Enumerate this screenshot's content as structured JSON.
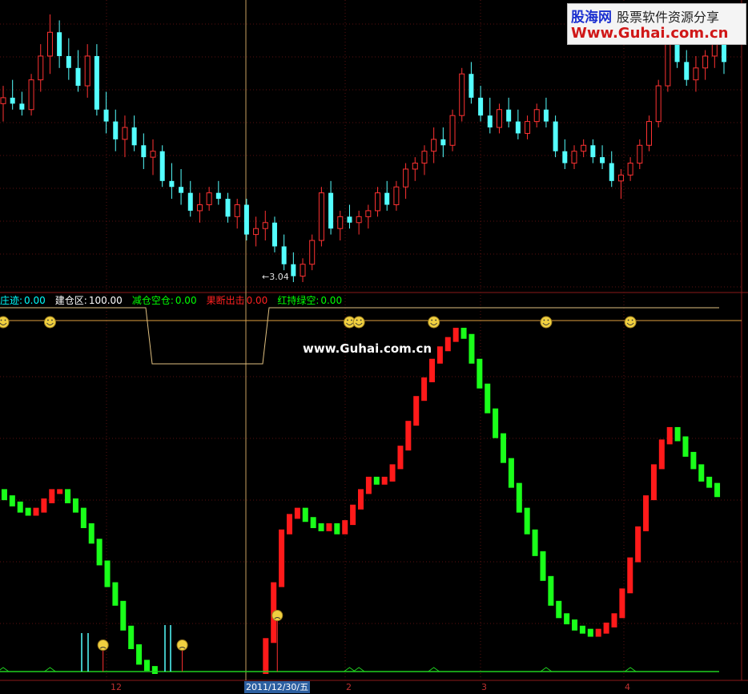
{
  "watermark": {
    "site_cn": "股海网",
    "slogan": "股票软件资源分享",
    "url": "Www.Guhai.com.cn"
  },
  "mid_watermark": "www.Guhai.com.cn",
  "indicator_legend": [
    {
      "label": "庄迹:",
      "value": "0.00",
      "color": "#00ffff"
    },
    {
      "label": "建仓区:",
      "value": "100.00",
      "color": "#ffffff"
    },
    {
      "label": "减仓空仓:",
      "value": "0.00",
      "color": "#00ff00"
    },
    {
      "label": "果断出击",
      "value": "0.00",
      "color": "#ff2020"
    },
    {
      "label": "红持绿空:",
      "value": "0.00",
      "color": "#00ff00"
    }
  ],
  "min_price_label": "←3.04",
  "x_axis": {
    "date_label": "2011/12/30/五",
    "month_ticks": [
      "12",
      "2",
      "3",
      "4"
    ]
  },
  "chart_data": {
    "type": "candlestick",
    "candles": [
      [
        3.64,
        3.7,
        3.58,
        3.66
      ],
      [
        3.66,
        3.72,
        3.62,
        3.64
      ],
      [
        3.64,
        3.68,
        3.6,
        3.62
      ],
      [
        3.62,
        3.74,
        3.6,
        3.72
      ],
      [
        3.72,
        3.84,
        3.68,
        3.8
      ],
      [
        3.8,
        3.94,
        3.74,
        3.88
      ],
      [
        3.88,
        3.92,
        3.76,
        3.8
      ],
      [
        3.8,
        3.86,
        3.72,
        3.76
      ],
      [
        3.76,
        3.82,
        3.68,
        3.7
      ],
      [
        3.7,
        3.84,
        3.66,
        3.8
      ],
      [
        3.8,
        3.84,
        3.6,
        3.62
      ],
      [
        3.62,
        3.68,
        3.54,
        3.58
      ],
      [
        3.58,
        3.62,
        3.48,
        3.52
      ],
      [
        3.52,
        3.6,
        3.46,
        3.56
      ],
      [
        3.56,
        3.6,
        3.48,
        3.5
      ],
      [
        3.5,
        3.54,
        3.42,
        3.46
      ],
      [
        3.46,
        3.52,
        3.4,
        3.48
      ],
      [
        3.48,
        3.5,
        3.36,
        3.38
      ],
      [
        3.38,
        3.44,
        3.32,
        3.36
      ],
      [
        3.36,
        3.42,
        3.3,
        3.34
      ],
      [
        3.34,
        3.38,
        3.26,
        3.28
      ],
      [
        3.28,
        3.34,
        3.24,
        3.3
      ],
      [
        3.3,
        3.36,
        3.28,
        3.34
      ],
      [
        3.34,
        3.38,
        3.3,
        3.32
      ],
      [
        3.32,
        3.34,
        3.24,
        3.26
      ],
      [
        3.26,
        3.32,
        3.22,
        3.3
      ],
      [
        3.3,
        3.32,
        3.18,
        3.2
      ],
      [
        3.2,
        3.26,
        3.16,
        3.22
      ],
      [
        3.22,
        3.28,
        3.18,
        3.24
      ],
      [
        3.24,
        3.26,
        3.14,
        3.16
      ],
      [
        3.16,
        3.2,
        3.08,
        3.1
      ],
      [
        3.1,
        3.14,
        3.04,
        3.06
      ],
      [
        3.06,
        3.12,
        3.04,
        3.1
      ],
      [
        3.1,
        3.2,
        3.08,
        3.18
      ],
      [
        3.18,
        3.36,
        3.16,
        3.34
      ],
      [
        3.34,
        3.38,
        3.2,
        3.22
      ],
      [
        3.22,
        3.28,
        3.18,
        3.26
      ],
      [
        3.26,
        3.3,
        3.22,
        3.24
      ],
      [
        3.24,
        3.28,
        3.2,
        3.26
      ],
      [
        3.26,
        3.3,
        3.22,
        3.28
      ],
      [
        3.28,
        3.36,
        3.26,
        3.34
      ],
      [
        3.34,
        3.38,
        3.28,
        3.3
      ],
      [
        3.3,
        3.38,
        3.28,
        3.36
      ],
      [
        3.36,
        3.44,
        3.32,
        3.42
      ],
      [
        3.42,
        3.46,
        3.38,
        3.44
      ],
      [
        3.44,
        3.5,
        3.4,
        3.48
      ],
      [
        3.48,
        3.56,
        3.44,
        3.52
      ],
      [
        3.52,
        3.56,
        3.46,
        3.5
      ],
      [
        3.5,
        3.62,
        3.48,
        3.6
      ],
      [
        3.6,
        3.76,
        3.58,
        3.74
      ],
      [
        3.74,
        3.78,
        3.64,
        3.66
      ],
      [
        3.66,
        3.7,
        3.58,
        3.6
      ],
      [
        3.6,
        3.66,
        3.54,
        3.56
      ],
      [
        3.56,
        3.64,
        3.54,
        3.62
      ],
      [
        3.62,
        3.66,
        3.56,
        3.58
      ],
      [
        3.58,
        3.62,
        3.52,
        3.54
      ],
      [
        3.54,
        3.6,
        3.52,
        3.58
      ],
      [
        3.58,
        3.64,
        3.56,
        3.62
      ],
      [
        3.62,
        3.66,
        3.56,
        3.58
      ],
      [
        3.58,
        3.6,
        3.46,
        3.48
      ],
      [
        3.48,
        3.52,
        3.42,
        3.44
      ],
      [
        3.44,
        3.5,
        3.42,
        3.48
      ],
      [
        3.48,
        3.52,
        3.46,
        3.5
      ],
      [
        3.5,
        3.52,
        3.44,
        3.46
      ],
      [
        3.46,
        3.5,
        3.42,
        3.44
      ],
      [
        3.44,
        3.48,
        3.36,
        3.38
      ],
      [
        3.38,
        3.42,
        3.32,
        3.4
      ],
      [
        3.4,
        3.46,
        3.38,
        3.44
      ],
      [
        3.44,
        3.52,
        3.42,
        3.5
      ],
      [
        3.5,
        3.6,
        3.48,
        3.58
      ],
      [
        3.58,
        3.72,
        3.56,
        3.7
      ],
      [
        3.7,
        3.9,
        3.68,
        3.86
      ],
      [
        3.86,
        3.9,
        3.76,
        3.78
      ],
      [
        3.78,
        3.82,
        3.7,
        3.72
      ],
      [
        3.72,
        3.8,
        3.68,
        3.76
      ],
      [
        3.76,
        3.82,
        3.72,
        3.8
      ],
      [
        3.8,
        3.92,
        3.76,
        3.84
      ],
      [
        3.84,
        3.88,
        3.74,
        3.78
      ]
    ],
    "indicator": {
      "name": "红持绿空",
      "values": [
        58,
        56,
        54,
        52,
        51,
        52,
        55,
        58,
        58,
        55,
        52,
        47,
        42,
        35,
        28,
        22,
        14,
        8,
        3,
        1,
        0,
        0,
        0,
        0,
        0,
        0,
        0,
        0,
        0,
        0,
        0,
        0,
        0,
        0,
        10,
        28,
        45,
        50,
        52,
        49,
        47,
        46,
        47,
        45,
        48,
        53,
        58,
        62,
        61,
        62,
        66,
        72,
        80,
        88,
        94,
        100,
        104,
        107,
        110,
        108,
        100,
        92,
        84,
        76,
        68,
        60,
        52,
        45,
        38,
        30,
        22,
        18,
        16,
        14,
        13,
        12,
        13,
        15,
        18,
        26,
        36,
        46,
        56,
        66,
        74,
        78,
        75,
        70,
        66,
        62,
        60,
        57
      ],
      "ylim": [
        0,
        110
      ]
    },
    "smiley_rows": {
      "top": [
        0,
        5,
        37,
        38,
        46,
        58,
        67,
        85
      ],
      "bottom_sad": [
        12,
        22,
        34
      ]
    }
  }
}
